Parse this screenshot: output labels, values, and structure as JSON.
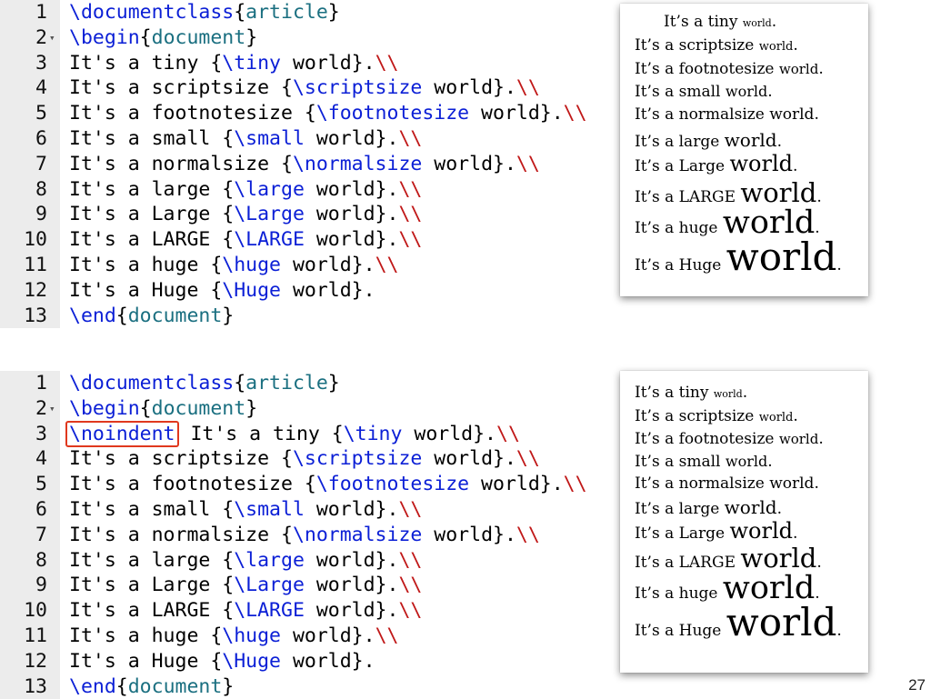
{
  "slide_number": "27",
  "code_block_1": {
    "lines": [
      {
        "num": "1",
        "fold": "",
        "tokens": [
          {
            "t": "\\documentclass",
            "c": "kw"
          },
          {
            "t": "{",
            "c": "plain"
          },
          {
            "t": "article",
            "c": "arg"
          },
          {
            "t": "}",
            "c": "plain"
          }
        ]
      },
      {
        "num": "2",
        "fold": "▾",
        "tokens": [
          {
            "t": "\\begin",
            "c": "kw"
          },
          {
            "t": "{",
            "c": "plain"
          },
          {
            "t": "document",
            "c": "arg"
          },
          {
            "t": "}",
            "c": "plain"
          }
        ]
      },
      {
        "num": "3",
        "fold": "",
        "tokens": [
          {
            "t": "It's a tiny {",
            "c": "plain"
          },
          {
            "t": "\\tiny",
            "c": "cmd"
          },
          {
            "t": " world}.",
            "c": "plain"
          },
          {
            "t": "\\\\",
            "c": "nl"
          }
        ]
      },
      {
        "num": "4",
        "fold": "",
        "tokens": [
          {
            "t": "It's a scriptsize {",
            "c": "plain"
          },
          {
            "t": "\\scriptsize",
            "c": "cmd"
          },
          {
            "t": " world}.",
            "c": "plain"
          },
          {
            "t": "\\\\",
            "c": "nl"
          }
        ]
      },
      {
        "num": "5",
        "fold": "",
        "tokens": [
          {
            "t": "It's a footnotesize {",
            "c": "plain"
          },
          {
            "t": "\\footnotesize",
            "c": "cmd"
          },
          {
            "t": " world}.",
            "c": "plain"
          },
          {
            "t": "\\\\",
            "c": "nl"
          }
        ]
      },
      {
        "num": "6",
        "fold": "",
        "tokens": [
          {
            "t": "It's a small {",
            "c": "plain"
          },
          {
            "t": "\\small",
            "c": "cmd"
          },
          {
            "t": " world}.",
            "c": "plain"
          },
          {
            "t": "\\\\",
            "c": "nl"
          }
        ]
      },
      {
        "num": "7",
        "fold": "",
        "tokens": [
          {
            "t": "It's a normalsize {",
            "c": "plain"
          },
          {
            "t": "\\normalsize",
            "c": "cmd"
          },
          {
            "t": " world}.",
            "c": "plain"
          },
          {
            "t": "\\\\",
            "c": "nl"
          }
        ]
      },
      {
        "num": "8",
        "fold": "",
        "tokens": [
          {
            "t": "It's a large {",
            "c": "plain"
          },
          {
            "t": "\\large",
            "c": "cmd"
          },
          {
            "t": " world}.",
            "c": "plain"
          },
          {
            "t": "\\\\",
            "c": "nl"
          }
        ]
      },
      {
        "num": "9",
        "fold": "",
        "tokens": [
          {
            "t": "It's a Large {",
            "c": "plain"
          },
          {
            "t": "\\Large",
            "c": "cmd"
          },
          {
            "t": " world}.",
            "c": "plain"
          },
          {
            "t": "\\\\",
            "c": "nl"
          }
        ]
      },
      {
        "num": "10",
        "fold": "",
        "tokens": [
          {
            "t": "It's a LARGE {",
            "c": "plain"
          },
          {
            "t": "\\LARGE",
            "c": "cmd"
          },
          {
            "t": " world}.",
            "c": "plain"
          },
          {
            "t": "\\\\",
            "c": "nl"
          }
        ]
      },
      {
        "num": "11",
        "fold": "",
        "tokens": [
          {
            "t": "It's a huge {",
            "c": "plain"
          },
          {
            "t": "\\huge",
            "c": "cmd"
          },
          {
            "t": " world}.",
            "c": "plain"
          },
          {
            "t": "\\\\",
            "c": "nl"
          }
        ]
      },
      {
        "num": "12",
        "fold": "",
        "tokens": [
          {
            "t": "It's a Huge {",
            "c": "plain"
          },
          {
            "t": "\\Huge",
            "c": "cmd"
          },
          {
            "t": " world}.",
            "c": "plain"
          }
        ]
      },
      {
        "num": "13",
        "fold": "",
        "tokens": [
          {
            "t": "\\end",
            "c": "kw"
          },
          {
            "t": "{",
            "c": "plain"
          },
          {
            "t": "document",
            "c": "arg"
          },
          {
            "t": "}",
            "c": "plain"
          }
        ]
      }
    ]
  },
  "code_block_2": {
    "lines": [
      {
        "num": "1",
        "fold": "",
        "tokens": [
          {
            "t": "\\documentclass",
            "c": "kw"
          },
          {
            "t": "{",
            "c": "plain"
          },
          {
            "t": "article",
            "c": "arg"
          },
          {
            "t": "}",
            "c": "plain"
          }
        ]
      },
      {
        "num": "2",
        "fold": "▾",
        "tokens": [
          {
            "t": "\\begin",
            "c": "kw"
          },
          {
            "t": "{",
            "c": "plain"
          },
          {
            "t": "document",
            "c": "arg"
          },
          {
            "t": "}",
            "c": "plain"
          }
        ]
      },
      {
        "num": "3",
        "fold": "",
        "tokens": [
          {
            "t": "\\noindent",
            "c": "cmd",
            "highlight": true
          },
          {
            "t": " It's a tiny {",
            "c": "plain"
          },
          {
            "t": "\\tiny",
            "c": "cmd"
          },
          {
            "t": " world}.",
            "c": "plain"
          },
          {
            "t": "\\\\",
            "c": "nl"
          }
        ]
      },
      {
        "num": "4",
        "fold": "",
        "tokens": [
          {
            "t": "It's a scriptsize {",
            "c": "plain"
          },
          {
            "t": "\\scriptsize",
            "c": "cmd"
          },
          {
            "t": " world}.",
            "c": "plain"
          },
          {
            "t": "\\\\",
            "c": "nl"
          }
        ]
      },
      {
        "num": "5",
        "fold": "",
        "tokens": [
          {
            "t": "It's a footnotesize {",
            "c": "plain"
          },
          {
            "t": "\\footnotesize",
            "c": "cmd"
          },
          {
            "t": " world}.",
            "c": "plain"
          },
          {
            "t": "\\\\",
            "c": "nl"
          }
        ]
      },
      {
        "num": "6",
        "fold": "",
        "tokens": [
          {
            "t": "It's a small {",
            "c": "plain"
          },
          {
            "t": "\\small",
            "c": "cmd"
          },
          {
            "t": " world}.",
            "c": "plain"
          },
          {
            "t": "\\\\",
            "c": "nl"
          }
        ]
      },
      {
        "num": "7",
        "fold": "",
        "tokens": [
          {
            "t": "It's a normalsize {",
            "c": "plain"
          },
          {
            "t": "\\normalsize",
            "c": "cmd"
          },
          {
            "t": " world}.",
            "c": "plain"
          },
          {
            "t": "\\\\",
            "c": "nl"
          }
        ]
      },
      {
        "num": "8",
        "fold": "",
        "tokens": [
          {
            "t": "It's a large {",
            "c": "plain"
          },
          {
            "t": "\\large",
            "c": "cmd"
          },
          {
            "t": " world}.",
            "c": "plain"
          },
          {
            "t": "\\\\",
            "c": "nl"
          }
        ]
      },
      {
        "num": "9",
        "fold": "",
        "tokens": [
          {
            "t": "It's a Large {",
            "c": "plain"
          },
          {
            "t": "\\Large",
            "c": "cmd"
          },
          {
            "t": " world}.",
            "c": "plain"
          },
          {
            "t": "\\\\",
            "c": "nl"
          }
        ]
      },
      {
        "num": "10",
        "fold": "",
        "tokens": [
          {
            "t": "It's a LARGE {",
            "c": "plain"
          },
          {
            "t": "\\LARGE",
            "c": "cmd"
          },
          {
            "t": " world}.",
            "c": "plain"
          },
          {
            "t": "\\\\",
            "c": "nl"
          }
        ]
      },
      {
        "num": "11",
        "fold": "",
        "tokens": [
          {
            "t": "It's a huge {",
            "c": "plain"
          },
          {
            "t": "\\huge",
            "c": "cmd"
          },
          {
            "t": " world}.",
            "c": "plain"
          },
          {
            "t": "\\\\",
            "c": "nl"
          }
        ]
      },
      {
        "num": "12",
        "fold": "",
        "tokens": [
          {
            "t": "It's a Huge {",
            "c": "plain"
          },
          {
            "t": "\\Huge",
            "c": "cmd"
          },
          {
            "t": " world}.",
            "c": "plain"
          }
        ]
      },
      {
        "num": "13",
        "fold": "",
        "tokens": [
          {
            "t": "\\end",
            "c": "kw"
          },
          {
            "t": "{",
            "c": "plain"
          },
          {
            "t": "document",
            "c": "arg"
          },
          {
            "t": "}",
            "c": "plain"
          }
        ]
      }
    ]
  },
  "preview_1": {
    "lines": [
      {
        "prefix": "It’s a tiny ",
        "word": "world",
        "suffix": ".",
        "size": "tiny"
      },
      {
        "prefix": "It’s a scriptsize ",
        "word": "world",
        "suffix": ".",
        "size": "script"
      },
      {
        "prefix": "It’s a footnotesize ",
        "word": "world",
        "suffix": ".",
        "size": "foot"
      },
      {
        "prefix": "It’s a small ",
        "word": "world",
        "suffix": ".",
        "size": "small"
      },
      {
        "prefix": "It’s a normalsize ",
        "word": "world",
        "suffix": ".",
        "size": "normal"
      },
      {
        "prefix": "It’s a large ",
        "word": "world",
        "suffix": ".",
        "size": "large"
      },
      {
        "prefix": "It’s a Large ",
        "word": "world",
        "suffix": ".",
        "size": "Large"
      },
      {
        "prefix": "It’s a LARGE ",
        "word": "world",
        "suffix": ".",
        "size": "LARGE"
      },
      {
        "prefix": "It’s a huge ",
        "word": "world",
        "suffix": ".",
        "size": "huge"
      },
      {
        "prefix": "It’s a Huge ",
        "word": "world",
        "suffix": ".",
        "size": "Huge"
      }
    ]
  },
  "preview_2": {
    "lines": [
      {
        "prefix": "It’s a tiny ",
        "word": "world",
        "suffix": ".",
        "size": "tiny"
      },
      {
        "prefix": "It’s a scriptsize ",
        "word": "world",
        "suffix": ".",
        "size": "script"
      },
      {
        "prefix": "It’s a footnotesize ",
        "word": "world",
        "suffix": ".",
        "size": "foot"
      },
      {
        "prefix": "It’s a small ",
        "word": "world",
        "suffix": ".",
        "size": "small"
      },
      {
        "prefix": "It’s a normalsize ",
        "word": "world",
        "suffix": ".",
        "size": "normal"
      },
      {
        "prefix": "It’s a large ",
        "word": "world",
        "suffix": ".",
        "size": "large"
      },
      {
        "prefix": "It’s a Large ",
        "word": "world",
        "suffix": ".",
        "size": "Large"
      },
      {
        "prefix": "It’s a LARGE ",
        "word": "world",
        "suffix": ".",
        "size": "LARGE"
      },
      {
        "prefix": "It’s a huge ",
        "word": "world",
        "suffix": ".",
        "size": "huge"
      },
      {
        "prefix": "It’s a Huge ",
        "word": "world",
        "suffix": ".",
        "size": "Huge"
      }
    ]
  },
  "colors": {
    "keyword": "#0b1fd6",
    "argument": "#1a6f80",
    "newline": "#c01818",
    "highlight_box": "#e0381e",
    "gutter": "#ececec"
  }
}
